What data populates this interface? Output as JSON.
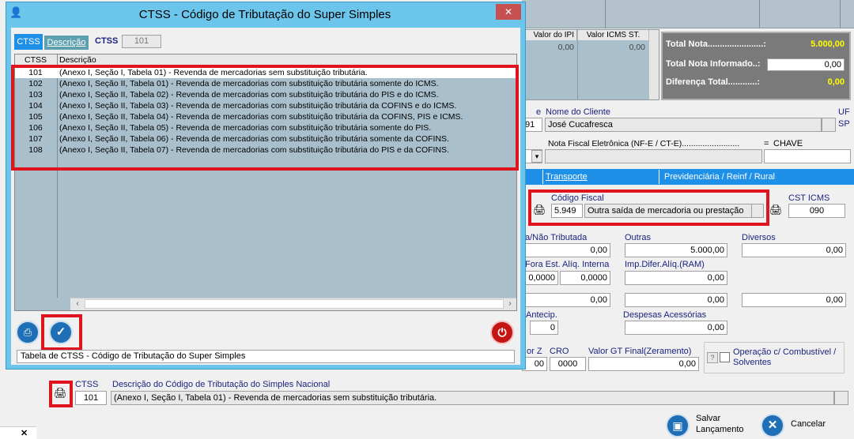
{
  "background": {
    "grid_headers": [
      "Valor do IPI",
      "Valor ICMS ST."
    ],
    "grid_values": [
      "0,00",
      "0,00"
    ],
    "totals": {
      "total_nota_label": "Total Nota.......................:",
      "total_nota_value": "5.000,00",
      "total_informado_label": "Total Nota Informado..:",
      "total_informado_value": "0,00",
      "diferenca_label": "Diferença Total............:",
      "diferenca_value": "0,00"
    },
    "client": {
      "code_label": "e",
      "code_value": "91",
      "name_label": "Nome do Cliente",
      "name_value": "José Cucafresca",
      "uf_label": "UF",
      "uf_value": "SP"
    },
    "nfe": {
      "label": "Nota Fiscal Eletrônica (NF-E / CT-E).........................",
      "equals": "=",
      "chave_label": "CHAVE"
    },
    "tabs": [
      "Transporte",
      "Previdenciária / Reinf / Rural"
    ],
    "cfop": {
      "label": "Código Fiscal",
      "code": "5.949",
      "description": "Outra saída de mercadoria ou prestação",
      "cst_label": "CST ICMS",
      "cst_value": "090"
    },
    "values_row1": {
      "nao_tributada_label": "a/Não Tributada",
      "nao_tributada_value": "0,00",
      "outras_label": "Outras",
      "outras_value": "5.000,00",
      "diversos_label": "Diversos",
      "diversos_value": "0,00"
    },
    "values_row2": {
      "fora_est_label": "Fora Est.",
      "fora_est_value": "0,0000",
      "aliq_interna_label": "Alíq. Interna",
      "aliq_interna_value": "0,0000",
      "imp_difer_label": "Imp.Difer.Alíq.(RAM)",
      "imp_difer_value": "0,00"
    },
    "values_row3": [
      "0,00",
      "0,00",
      "0,00"
    ],
    "antecip": {
      "label": "Antecip.",
      "value": "0",
      "despesas_label": "Despesas Acessórias",
      "despesas_value": "0,00"
    },
    "ecf": {
      "contador_z_label": "or Z",
      "contador_z_value": "00",
      "cro_label": "CRO",
      "cro_value": "0000",
      "gt_label": "Valor GT Final(Zeramento)",
      "gt_value": "0,00",
      "question_label": "?",
      "combustivel_label_1": "Operação c/ Combustível /",
      "combustivel_label_2": "Solventes"
    },
    "ctss_field": {
      "label": "CTSS",
      "value": "101",
      "desc_label": "Descrição do Código de Tributação do Simples Nacional",
      "desc_value": "(Anexo I, Seção I, Tabela 01) - Revenda de mercadorias sem substituição tributária."
    },
    "actions": {
      "salvar_1": "Salvar",
      "salvar_2": "Lançamento",
      "cancelar": "Cancelar"
    },
    "corner_close": "✕"
  },
  "dialog": {
    "title": "CTSS - Código de Tributação do Super Simples",
    "close_glyph": "✕",
    "tabs": [
      "CTSS",
      "Descrição"
    ],
    "search_label": "CTSS",
    "search_value": "101",
    "columns": [
      "CTSS",
      "Descrição"
    ],
    "rows": [
      {
        "code": "101",
        "desc": "(Anexo I, Seção I, Tabela 01) - Revenda de mercadorias sem substituição tributária."
      },
      {
        "code": "102",
        "desc": "(Anexo I, Seção II, Tabela 01) - Revenda de mercadorias com substituição tributária somente do ICMS."
      },
      {
        "code": "103",
        "desc": "(Anexo I, Seção II, Tabela 02) - Revenda de mercadorias com substituição tributária do PIS e do ICMS."
      },
      {
        "code": "104",
        "desc": "(Anexo I, Seção II, Tabela 03) - Revenda de mercadorias com substituição tributária da COFINS e do ICMS."
      },
      {
        "code": "105",
        "desc": "(Anexo I, Seção II, Tabela 04) - Revenda de mercadorias com substituição tributária da COFINS, PIS e ICMS."
      },
      {
        "code": "106",
        "desc": "(Anexo I, Seção II, Tabela 05) - Revenda de mercadorias com substituição tributária somente do PIS."
      },
      {
        "code": "107",
        "desc": "(Anexo I, Seção II, Tabela 06) - Revenda de mercadorias com substituição tributária somente da COFINS."
      },
      {
        "code": "108",
        "desc": "(Anexo I, Seção II, Tabela 07) - Revenda de mercadorias com substituição tributária do PIS e da COFINS."
      }
    ],
    "status_text": "Tabela de CTSS - Código de Tributação do Super Simples",
    "icons": {
      "print": "printer-icon",
      "confirm": "checkmark-icon",
      "power": "power-icon"
    },
    "colors": {
      "title_bar": "#6cc5ea",
      "list_bg": "#a9bfcc",
      "selected_row": "#ffffff",
      "red_highlight": "#e0141e"
    }
  }
}
